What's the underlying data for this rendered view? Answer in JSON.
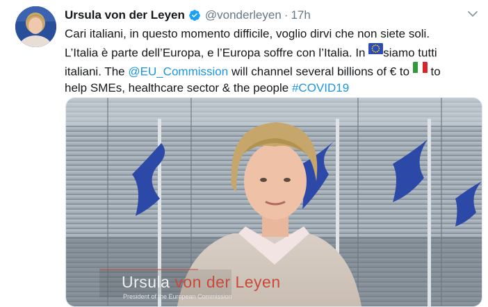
{
  "tweet": {
    "author_name": "Ursula von der Leyen",
    "handle": "@vonderleyen",
    "separator": "·",
    "timestamp": "17h",
    "text": {
      "line1": "Cari italiani, in questo momento difficile, voglio dirvi che non siete soli.",
      "line2a": "L’Italia è parte dell’Europa, e l’Europa soffre con l’Italia. In ",
      "line2b": "siamo tutti",
      "line3a": "italiani. The ",
      "mention": "@EU_Commission",
      "line3b": " will channel several billions of € to ",
      "line3c": " to",
      "line4a": "help SMEs, healthcare sector & the people ",
      "hashtag": "#COVID19"
    },
    "icons": {
      "verified": "verified-badge-icon",
      "more": "chevron-down-icon",
      "eu_flag": "eu-flag-emoji",
      "it_flag": "italy-flag-emoji"
    },
    "colors": {
      "link": "#1b95e0",
      "secondary": "#657786",
      "verified": "#1da1f2"
    },
    "media": {
      "caption_first": "Ursula",
      "caption_rest": " von der Leyen",
      "caption_sub": "President of the European Commission"
    }
  }
}
